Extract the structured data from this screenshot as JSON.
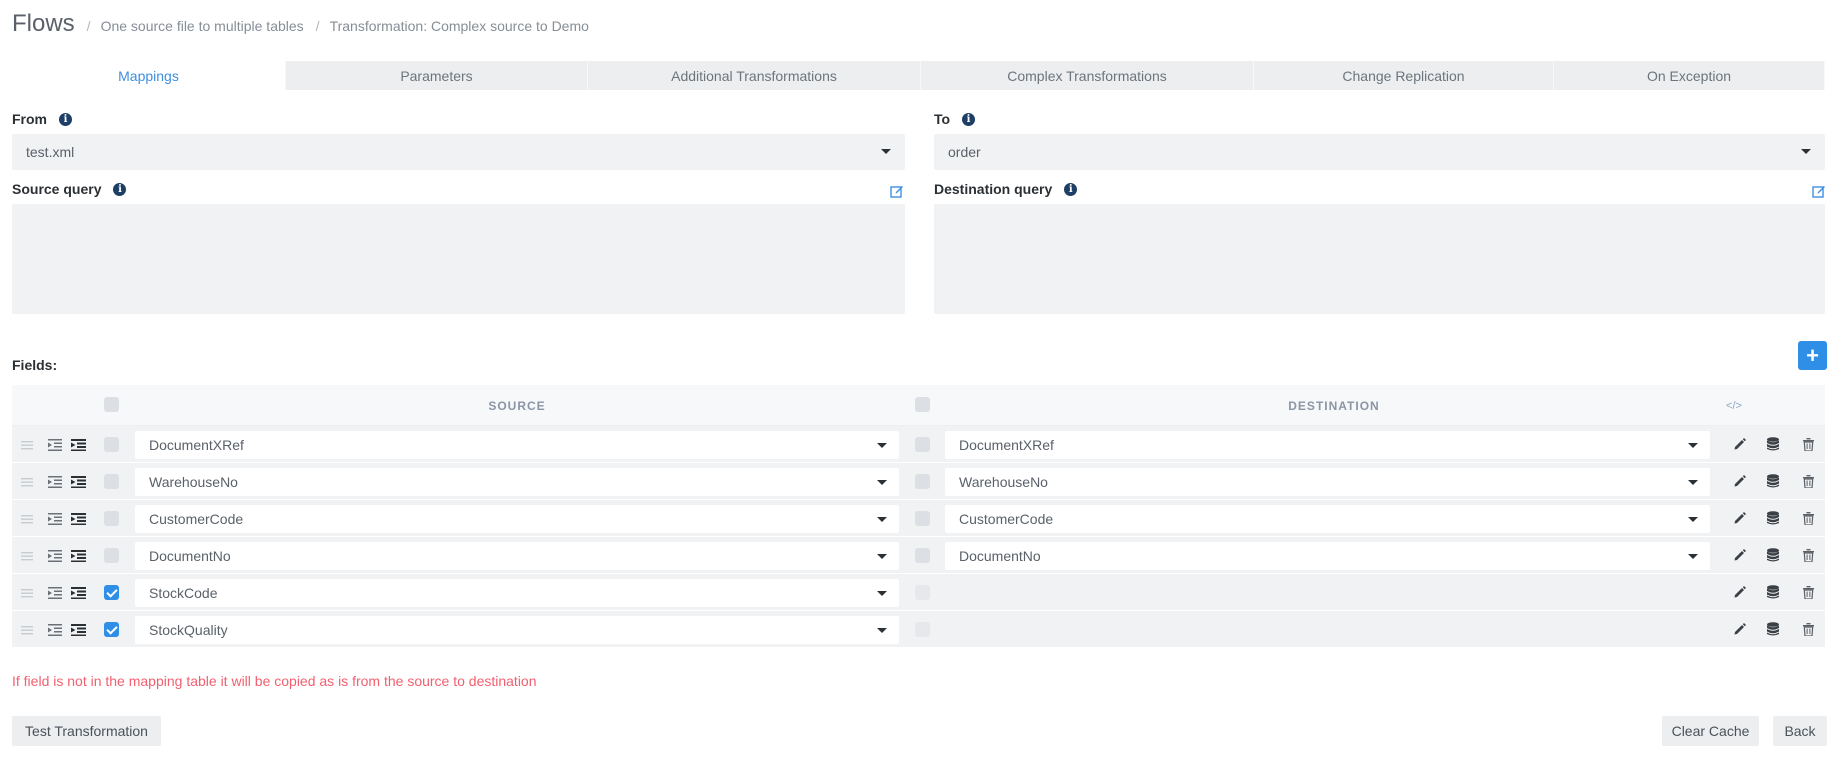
{
  "header": {
    "title": "Flows",
    "separator": "/",
    "breadcrumbs": [
      "One source file to multiple tables",
      "Transformation: Complex source to Demo"
    ]
  },
  "tabs": [
    {
      "label": "Mappings",
      "active": true
    },
    {
      "label": "Parameters",
      "active": false
    },
    {
      "label": "Additional Transformations",
      "active": false
    },
    {
      "label": "Complex Transformations",
      "active": false
    },
    {
      "label": "Change Replication",
      "active": false
    },
    {
      "label": "On Exception",
      "active": false
    }
  ],
  "from": {
    "label": "From",
    "value": "test.xml",
    "icon": "info-icon"
  },
  "to": {
    "label": "To",
    "value": "order",
    "icon": "info-icon"
  },
  "source_query": {
    "label": "Source query",
    "value": ""
  },
  "destination_query": {
    "label": "Destination query",
    "value": ""
  },
  "fields": {
    "label": "Fields:",
    "add_label": "+",
    "columns": {
      "source": "SOURCE",
      "destination": "DESTINATION",
      "code_icon": "</>"
    },
    "rows": [
      {
        "source": "DocumentXRef",
        "destination": "DocumentXRef",
        "source_checked": false,
        "has_destination": true
      },
      {
        "source": "WarehouseNo",
        "destination": "WarehouseNo",
        "source_checked": false,
        "has_destination": true
      },
      {
        "source": "CustomerCode",
        "destination": "CustomerCode",
        "source_checked": false,
        "has_destination": true
      },
      {
        "source": "DocumentNo",
        "destination": "DocumentNo",
        "source_checked": false,
        "has_destination": true
      },
      {
        "source": "StockCode",
        "destination": "",
        "source_checked": true,
        "has_destination": false
      },
      {
        "source": "StockQuality",
        "destination": "",
        "source_checked": true,
        "has_destination": false
      }
    ]
  },
  "hint": "If field is not in the mapping table it will be copied as is from the source to destination",
  "buttons": {
    "test": "Test Transformation",
    "clear_cache": "Clear Cache",
    "back": "Back"
  },
  "colors": {
    "accent": "#2f8ee5",
    "active_tab": "#3f8fe0",
    "hint": "#f2606f",
    "info_icon": "#1d3f66"
  }
}
